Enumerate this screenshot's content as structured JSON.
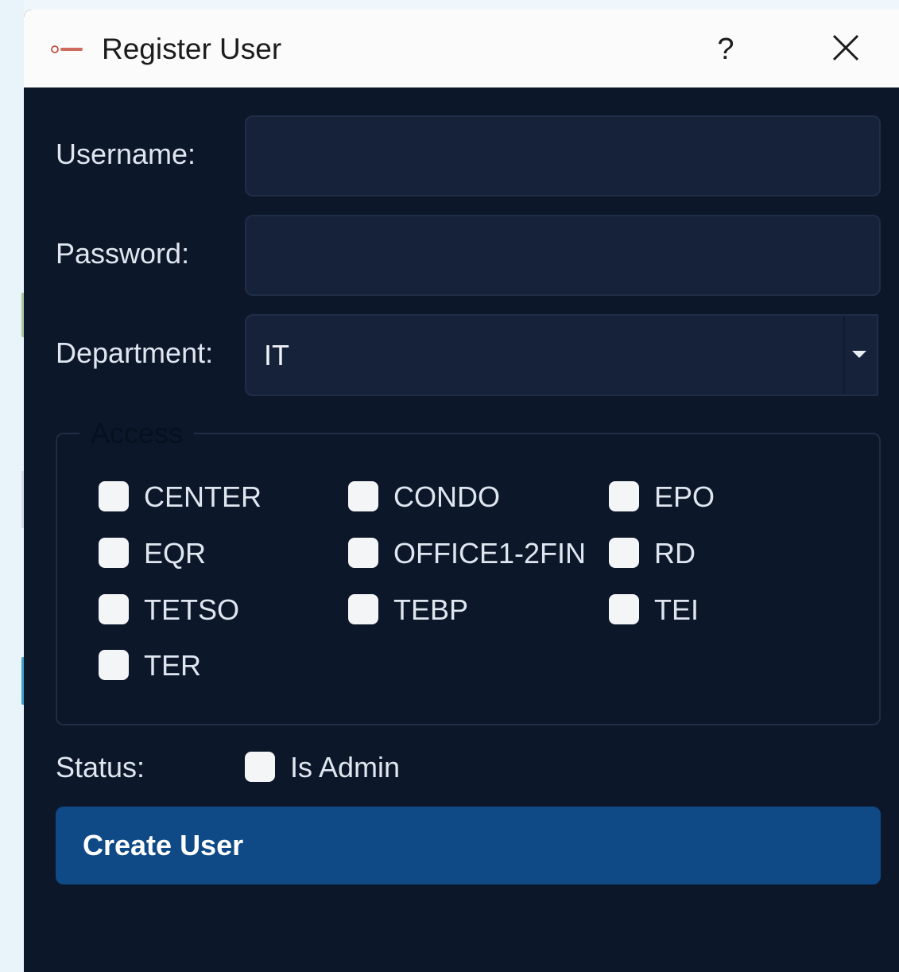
{
  "window": {
    "title": "Register User",
    "help_label": "?",
    "icons": {
      "app": "app-logo-icon",
      "close": "close-icon"
    }
  },
  "form": {
    "username_label": "Username:",
    "username_value": "",
    "password_label": "Password:",
    "password_value": "",
    "department_label": "Department:",
    "department_value": "IT"
  },
  "access": {
    "title": "Access",
    "items": [
      {
        "label": "CENTER",
        "checked": false
      },
      {
        "label": "CONDO",
        "checked": false
      },
      {
        "label": "EPO",
        "checked": false
      },
      {
        "label": "EQR",
        "checked": false
      },
      {
        "label": "OFFICE1-2FIN",
        "checked": false
      },
      {
        "label": "RD",
        "checked": false
      },
      {
        "label": "TETSO",
        "checked": false
      },
      {
        "label": "TEBP",
        "checked": false
      },
      {
        "label": "TEI",
        "checked": false
      },
      {
        "label": "TER",
        "checked": false
      }
    ]
  },
  "status": {
    "label": "Status:",
    "is_admin_label": "Is Admin",
    "is_admin_checked": false
  },
  "actions": {
    "create_label": "Create User"
  },
  "colors": {
    "dialog_bg": "#0c1729",
    "field_bg": "#16223a",
    "button_bg": "#0f4a86",
    "titlebar_bg": "#fbfbfb"
  }
}
